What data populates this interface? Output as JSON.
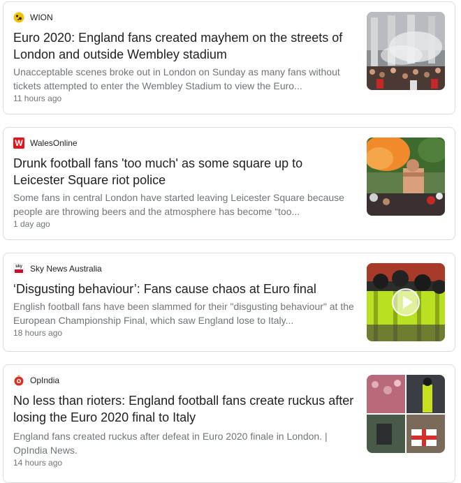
{
  "articles": [
    {
      "source": "WION",
      "favicon_icon": "wion-logo-icon",
      "headline": "Euro 2020: England fans created mayhem on the streets of London and outside Wembley stadium",
      "snippet": "Unacceptable scenes broke out in London on Sunday as many fans without tickets attempted to enter the Wembley Stadium to view the Euro...",
      "time": "11 hours ago"
    },
    {
      "source": "WalesOnline",
      "favicon_icon": "walesonline-logo-icon",
      "favicon_letter": "W",
      "headline": "Drunk football fans 'too much' as some square up to Leicester Square riot police",
      "snippet": "Some fans in central London have started leaving Leicester Square because people are throwing beers and the atmosphere has become “too...",
      "time": "1 day ago"
    },
    {
      "source": "Sky News Australia",
      "favicon_icon": "sky-news-logo-icon",
      "favicon_letter": "sky",
      "headline": "‘Disgusting behaviour’: Fans cause chaos at Euro final",
      "snippet": "English football fans have been slammed for their \"disgusting behaviour\" at the European Championship Final, which saw England lose to Italy...",
      "time": "18 hours ago",
      "has_video": true
    },
    {
      "source": "OpIndia",
      "favicon_icon": "opindia-logo-icon",
      "headline": "No less than rioters: England football fans create ruckus after losing the Euro 2020 final to Italy",
      "snippet": "England fans created ruckus after defeat in Euro 2020 finale in London. | OpIndia News.",
      "time": "14 hours ago"
    }
  ],
  "colors": {
    "card_border": "#dadce0",
    "headline": "#202124",
    "snippet": "#70757a",
    "walesonline_red": "#e8141b",
    "sky_red": "#c8102e",
    "opindia_red": "#d93025",
    "wion_yellow": "#f4c20d"
  }
}
